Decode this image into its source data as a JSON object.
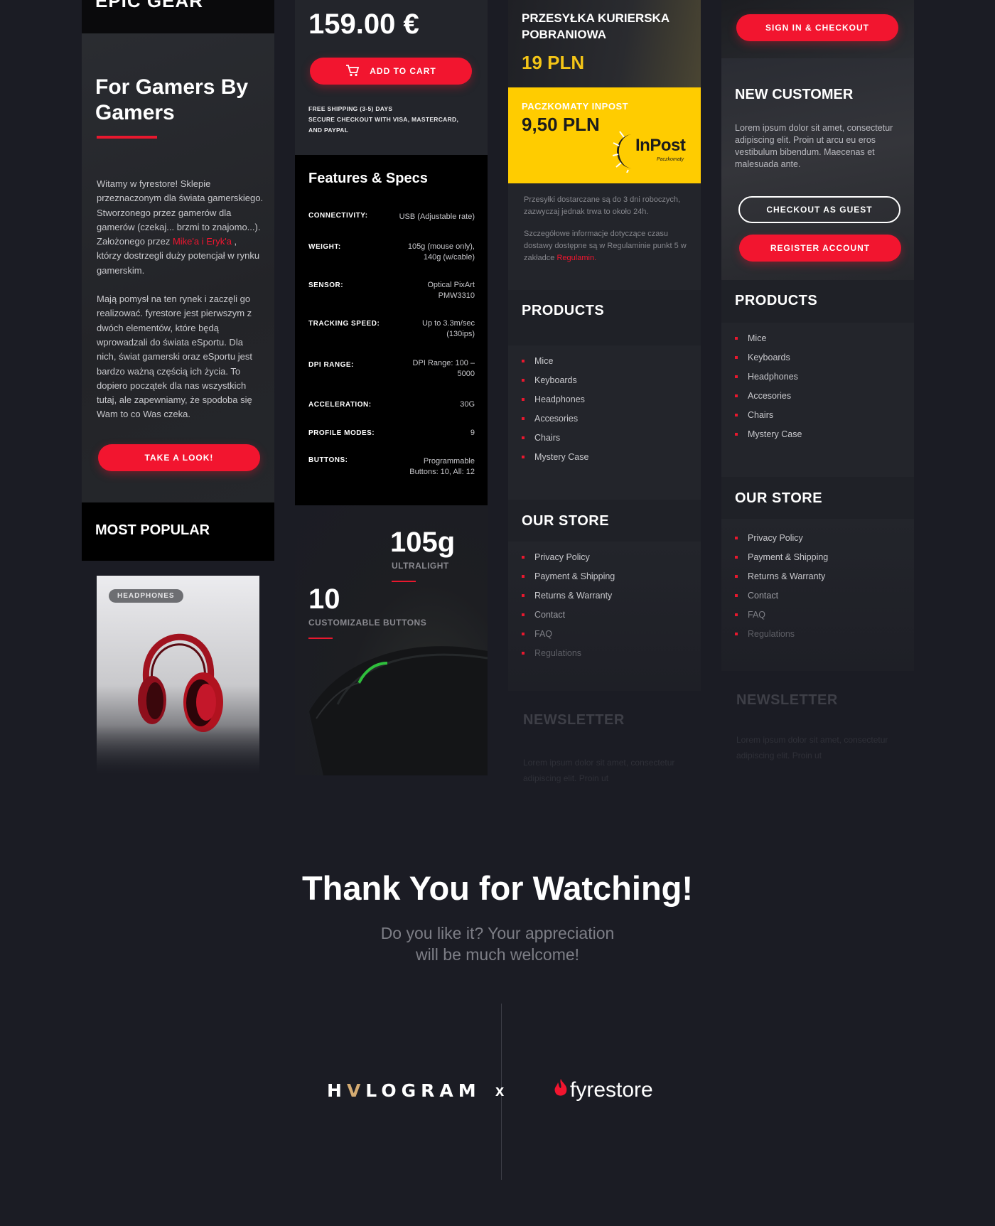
{
  "col1": {
    "top_title": "EPIC GEAR",
    "hero_title": "For Gamers By Gamers",
    "para1_a": "Witamy w fyrestore! Sklepie przeznaczonym dla świata gamerskiego. Stworzonego przez gamerów dla gamerów (czekaj... brzmi to znajomo...). Założonego przez ",
    "para1_link": "Mike'a i Eryk'a",
    "para1_b": " , którzy dostrzegli duży potencjał w rynku gamerskim.",
    "para2": "Mają pomysł na ten rynek i zaczęli go realizować. fyrestore jest pierwszym z dwóch elementów, które będą wprowadzali do świata eSportu. Dla nich, świat gamerski oraz eSportu jest bardzo ważną częścią ich życia. To dopiero początek dla nas wszystkich tutaj, ale zapewniamy, że spodoba się Wam to co Was czeka.",
    "cta": "TAKE A LOOK!",
    "most_popular": "MOST POPULAR",
    "badge": "HEADPHONES"
  },
  "col2": {
    "price": "159.00 €",
    "add_to_cart": "ADD TO CART",
    "ship1": "FREE SHIPPING (3-5) DAYS",
    "ship2": "SECURE CHECKOUT WITH VISA, MASTERCARD,",
    "ship3": "AND PAYPAL",
    "specs_title": "Features & Specs",
    "specs": [
      {
        "key": "CONNECTIVITY:",
        "value": "USB (Adjustable rate)"
      },
      {
        "key": "WEIGHT:",
        "value": "105g (mouse only), 140g (w/cable)"
      },
      {
        "key": "SENSOR:",
        "value": "Optical PixArt PMW3310"
      },
      {
        "key": "TRACKING SPEED:",
        "value": "Up to 3.3m/sec (130ips)"
      },
      {
        "key": "DPI RANGE:",
        "value": "DPI Range: 100 – 5000"
      },
      {
        "key": "ACCELERATION:",
        "value": "30G"
      },
      {
        "key": "PROFILE MODES:",
        "value": "9"
      },
      {
        "key": "BUTTONS:",
        "value": "Programmable Buttons: 10, All: 12"
      }
    ],
    "weight_big": "105g",
    "weight_label": "ULTRALIGHT",
    "buttons_big": "10",
    "buttons_label": "CUSTOMIZABLE BUTTONS"
  },
  "col3": {
    "courier_title": "PRZESYŁKA KURIERSKA POBRANIOWA",
    "courier_price": "19 PLN",
    "inpost_label": "PACZKOMATY INPOST",
    "inpost_price": "9,50 PLN",
    "inpost_logo": "InPost",
    "inpost_logo_sub": "Paczkomaty",
    "note1": "Przesyłki dostarczane są do 3 dni roboczych, zazwyczaj jednak trwa to około 24h.",
    "note2": "Szczegółowe informacje dotyczące czasu dostawy dostępne są w Regulaminie punkt 5 w zakładce ",
    "note2_link": "Regulamin",
    "note2_end": ".",
    "products_title": "PRODUCTS",
    "products": [
      "Mice",
      "Keyboards",
      "Headphones",
      "Accesories",
      "Chairs",
      "Mystery Case"
    ],
    "store_title": "OUR STORE",
    "store": [
      "Privacy Policy",
      "Payment & Shipping",
      "Returns & Warranty",
      "Contact",
      "FAQ",
      "Regulations"
    ],
    "newsletter": "NEWSLETTER",
    "newsletter_text": "Lorem ipsum dolor sit amet, consectetur adipiscing elit. Proin ut"
  },
  "col4": {
    "sign_in": "SIGN IN & CHECKOUT",
    "new_customer": "NEW CUSTOMER",
    "new_customer_text": "Lorem ipsum dolor sit amet, consectetur adipiscing elit. Proin ut arcu eu eros vestibulum bibendum. Maecenas et malesuada ante.",
    "guest": "CHECKOUT AS GUEST",
    "register": "REGISTER ACCOUNT",
    "products_title": "PRODUCTS",
    "products": [
      "Mice",
      "Keyboards",
      "Headphones",
      "Accesories",
      "Chairs",
      "Mystery Case"
    ],
    "store_title": "OUR STORE",
    "store": [
      "Privacy Policy",
      "Payment & Shipping",
      "Returns & Warranty",
      "Contact",
      "FAQ",
      "Regulations"
    ],
    "newsletter": "NEWSLETTER",
    "newsletter_text": "Lorem ipsum dolor sit amet, consectetur adipiscing elit. Proin ut"
  },
  "footer": {
    "thanks": "Thank You for Watching!",
    "sub1": "Do you like it? Your appreciation",
    "sub2": "will be much welcome!",
    "logo_left_a": "H",
    "logo_left_v": "V",
    "logo_left_b": "LOGRAM",
    "times": "x",
    "logo_right": "fyrestore"
  },
  "colors": {
    "accent": "#f2152f",
    "inpost_yellow": "#ffcc00",
    "price_gold": "#f4c517",
    "bg": "#1b1c24"
  }
}
